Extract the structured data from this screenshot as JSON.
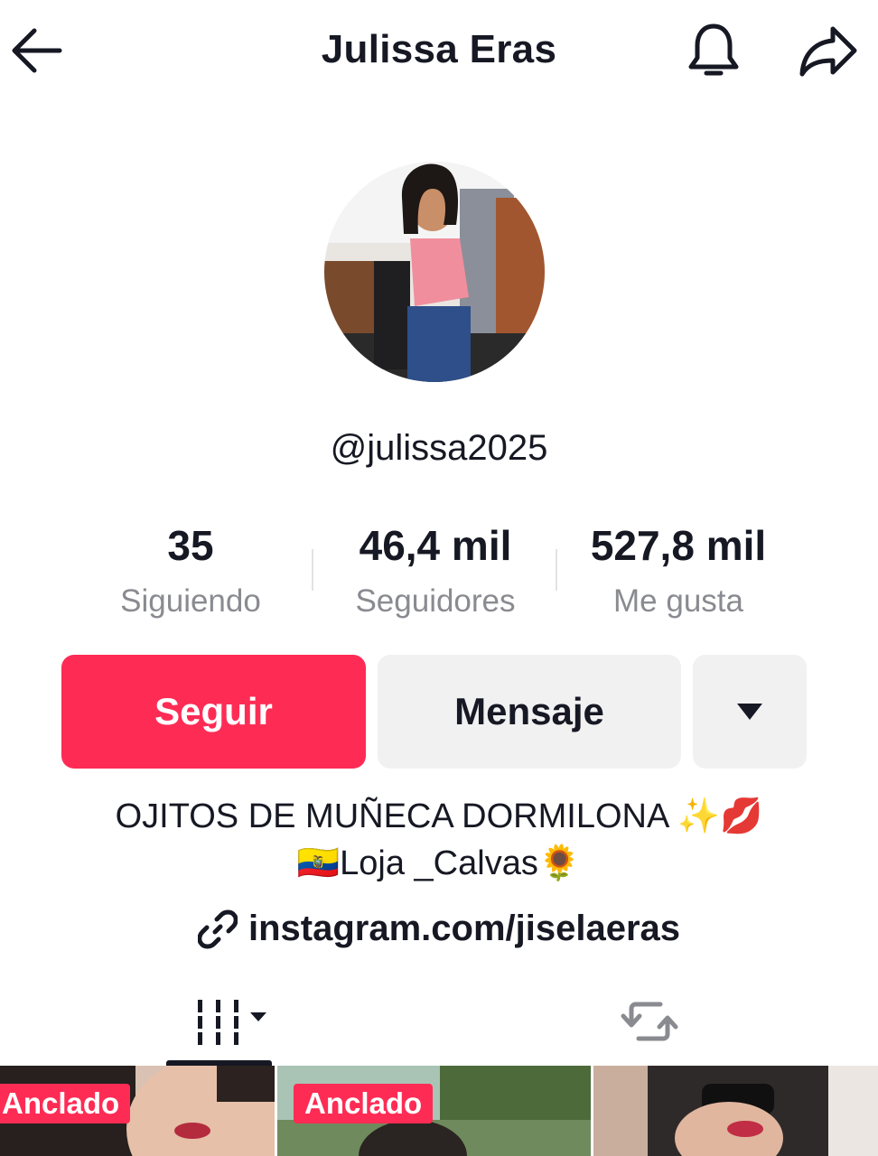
{
  "header": {
    "title": "Julissa Eras"
  },
  "profile": {
    "username": "@julissa2025",
    "stats": [
      {
        "value": "35",
        "label": "Siguiendo"
      },
      {
        "value": "46,4 mil",
        "label": "Seguidores"
      },
      {
        "value": "527,8 mil",
        "label": "Me gusta"
      }
    ],
    "follow_label": "Seguir",
    "message_label": "Mensaje",
    "bio_line1": "OJITOS DE MUÑECA DORMILONA ✨💋",
    "bio_line2": "🇪🇨Loja _Calvas🌻",
    "link": "instagram.com/jiselaeras"
  },
  "tabs": [
    {
      "name": "videos",
      "icon": "grid-icon",
      "active": true
    },
    {
      "name": "reposts",
      "icon": "repost-icon",
      "active": false
    }
  ],
  "videos": [
    {
      "badge": "Anclado"
    },
    {
      "badge": "Anclado"
    },
    {
      "badge": ""
    }
  ],
  "colors": {
    "accent": "#fe2c55",
    "text": "#161823",
    "muted": "#8a8b91",
    "button_secondary": "#f1f1f2"
  }
}
